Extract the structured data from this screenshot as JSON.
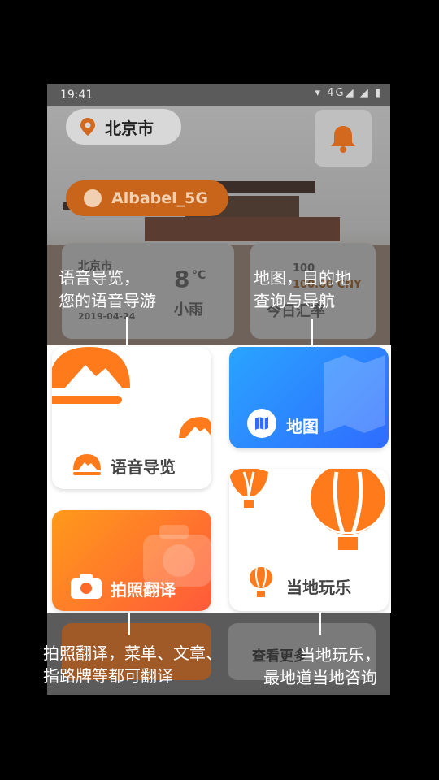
{
  "status_bar": {
    "time": "19:41",
    "network": "4G"
  },
  "header": {
    "city": "北京市"
  },
  "wifi": {
    "name": "Albabel_5G"
  },
  "weather": {
    "city": "北京市",
    "temp": "8",
    "unit": "°C",
    "condition": "小雨",
    "date": "2019-04-24"
  },
  "exchange": {
    "line1": "100",
    "line2": "100.00 CNY",
    "label": "今日汇率"
  },
  "cards": {
    "audio_guide": {
      "label": "语音导览"
    },
    "map": {
      "label": "地图"
    },
    "photo_translate": {
      "label": "拍照翻译"
    },
    "local_fun": {
      "label": "当地玩乐"
    }
  },
  "bottom_peek": {
    "more": "查看更多"
  },
  "callouts": {
    "top_left_line1": "语音导览，",
    "top_left_line2": "您的语音导游",
    "top_right_line1": "地图，目的地",
    "top_right_line2": "查询与导航",
    "bottom_left_line1": "拍照翻译，菜单、文章、",
    "bottom_left_line2": "指路牌等都可翻译",
    "bottom_right_line1": "当地玩乐，",
    "bottom_right_line2": "最地道当地咨询"
  },
  "colors": {
    "orange": "#ff7a1a",
    "blue": "#2f8cff",
    "overlay": "#5b5b5b"
  }
}
